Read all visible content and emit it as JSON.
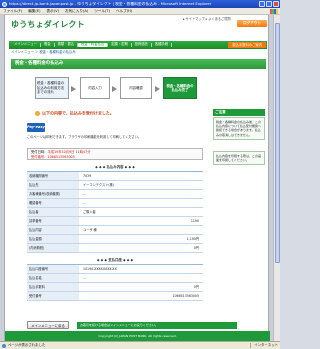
{
  "window": {
    "title": "https://direct.jp-bank.japanpost.jp - ゆうちょダイレクト | 税金・各種料金の払込み - Microsoft Internet Explorer"
  },
  "menubar": {
    "items": [
      "ファイル(F)",
      "編集(E)",
      "表示(V)",
      "お気に入り(A)",
      "ツール(T)",
      "ヘルプ(H)"
    ]
  },
  "site": {
    "logo": "ゆうちょダイレクト",
    "top_links": "▸ サイトマップ ▸ よくあるご質問",
    "logout_label": "ログアウト"
  },
  "nav": {
    "items": [
      "メインメニュー",
      "照会",
      "振替・振込",
      "税金・料金払込",
      "定額・定期",
      "投資信託",
      "各種手続",
      "サービス案内",
      "ゆうちょ・各種サービス",
      "振込手数料のご案内"
    ],
    "active_index": 3
  },
  "breadcrumb": "メインメニュー ＞ 税金・各種料金の払込み",
  "section_title": "税金・各種料金の払込み",
  "steps": {
    "s1": "税金・各種料金の払込みの利用方法までの流れ",
    "s2": "内容入力",
    "s3": "内容確認",
    "s4": "税金・各種料金の払込み完了"
  },
  "notice": "以下の内容で、払込みを受付けました。",
  "pay_logo": "Pay-easy",
  "description": "このページは印刷できます。ブラウザの印刷機能を利用して印刷してください。",
  "datebox": {
    "label": "受付日時：",
    "value": "平成19年10月9日 11時47分",
    "receipt": "受付番号：1066513563005"
  },
  "table1": {
    "title": "◆ ◆ ◆  払込み内容  ◆ ◆ ◆",
    "rows": [
      {
        "k": "収納機関番号",
        "v": "7039"
      },
      {
        "k": "払込先",
        "v": "イーコンテクスト(株)"
      },
      {
        "k": "お客様番号(収納機関)",
        "v": "…"
      },
      {
        "k": "確認番号",
        "v": "…"
      },
      {
        "k": "払込者",
        "v": "ご購入者"
      },
      {
        "k": "請求番号",
        "v": "1190"
      },
      {
        "k": "払込内容",
        "v": "ユーザ 様"
      },
      {
        "k": "払込金額",
        "v": "1,190円"
      },
      {
        "k": "(内消費税)",
        "v": "0円"
      }
    ]
  },
  "table2": {
    "title": "◆ ◆ ◆  支払口座  ◆ ◆ ◆",
    "rows": [
      {
        "k": "払込口座番号",
        "v": "10190-XXXXXXXX-XX"
      },
      {
        "k": "払込名義",
        "v": "…"
      },
      {
        "k": "払込手数料",
        "v": "0円"
      },
      {
        "k": "受付番号",
        "v": "1066513563005"
      }
    ]
  },
  "sidebar": {
    "head": "ご注意",
    "box1": "税金・各種料金の払込み後、この払込内容について払込受付機関へ確認できる場合があります。払込みの取消しはできません。",
    "box2": "払込内容を印刷する際は、この画面を印刷してください。"
  },
  "back_button": "メインメニューに戻る",
  "bottom_bar": "お取引を続ける場合はメインメニューにお戻りください。",
  "footer": "Copyright (C) JAPAN POST BANK. All rights reserved.",
  "statusbar": {
    "text": "ページが表示されました",
    "zone": "インターネット"
  }
}
